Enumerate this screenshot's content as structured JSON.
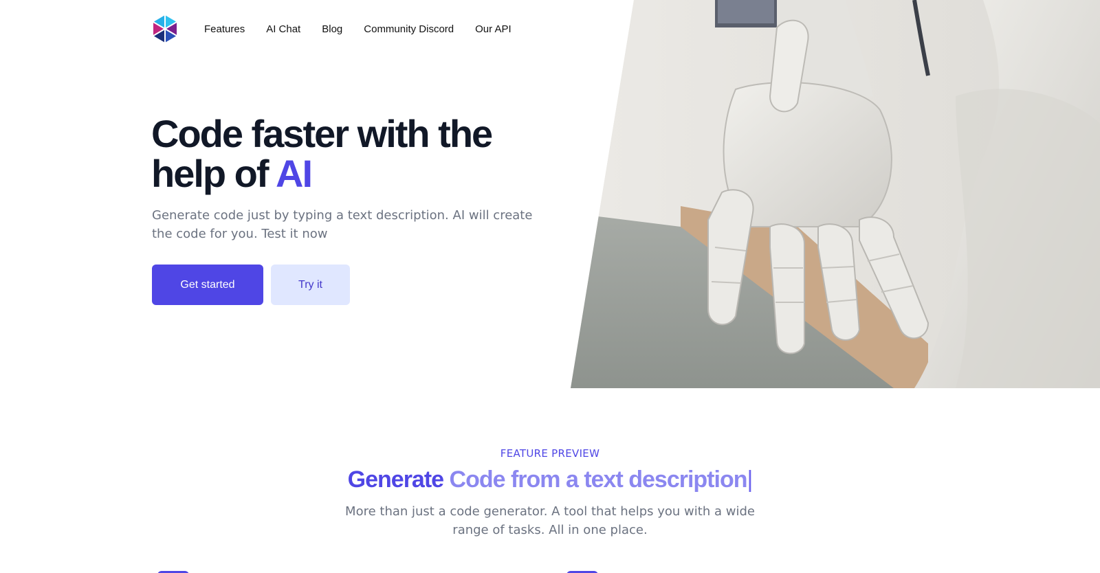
{
  "nav": {
    "logo": "app-logo",
    "links": [
      "Features",
      "AI Chat",
      "Blog",
      "Community Discord",
      "Our API"
    ]
  },
  "hero": {
    "title_line1": "Code faster with the",
    "title_line2_prefix": "help of ",
    "title_accent": "AI",
    "subtitle": "Generate code just by typing a text description. AI will create the code for you. Test it now",
    "primary_button": "Get started",
    "secondary_button": "Try it",
    "image": "robot-hand-photo"
  },
  "feature_preview": {
    "eyebrow": "FEATURE PREVIEW",
    "title_strong": "Generate",
    "title_light": " Code from a text description",
    "caret": "|",
    "subtitle": "More than just a code generator. A tool that helps you with a wide range of tasks. All in one place."
  },
  "colors": {
    "accent": "#4f46e5",
    "accent_light": "#8b87f0",
    "secondary_bg": "#e0e7ff",
    "heading": "#111827",
    "muted": "#6b7280"
  }
}
